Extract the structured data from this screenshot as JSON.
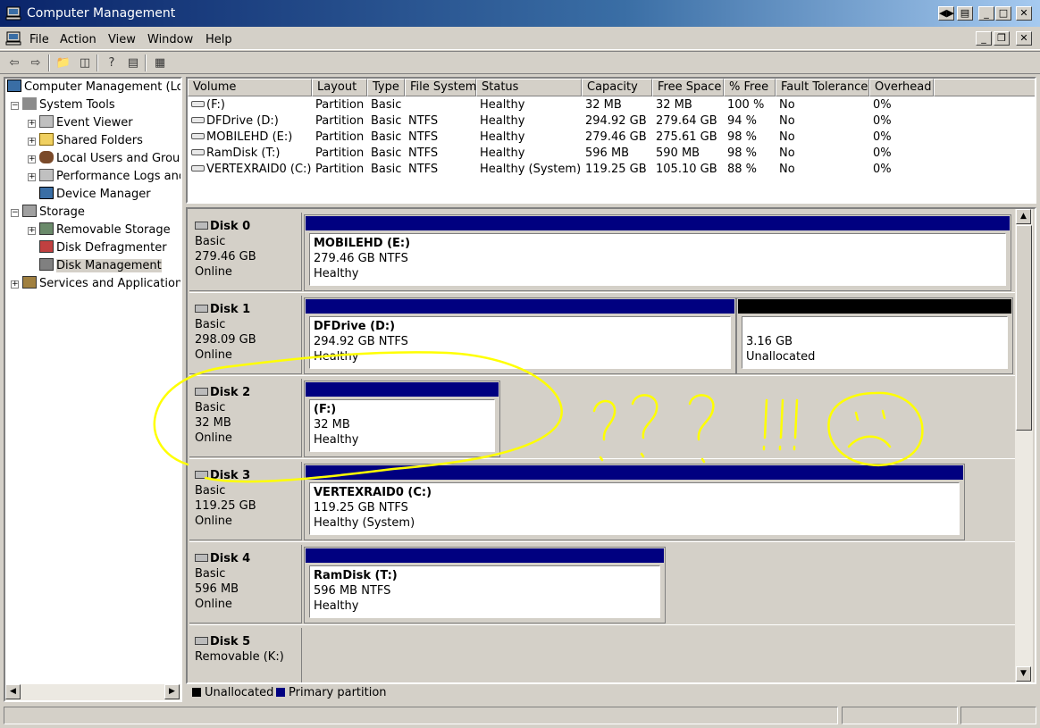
{
  "window": {
    "title": "Computer Management"
  },
  "menu": [
    "File",
    "Action",
    "View",
    "Window",
    "Help"
  ],
  "tree": {
    "items": [
      {
        "label": "Computer Management (Loc",
        "icon": "computer-icon"
      },
      {
        "label": "System Tools",
        "icon": "tools-icon"
      },
      {
        "label": "Event Viewer",
        "icon": "event-viewer-icon"
      },
      {
        "label": "Shared Folders",
        "icon": "folder-icon"
      },
      {
        "label": "Local Users and Group",
        "icon": "users-icon"
      },
      {
        "label": "Performance Logs and",
        "icon": "performance-icon"
      },
      {
        "label": "Device Manager",
        "icon": "device-icon"
      },
      {
        "label": "Storage",
        "icon": "storage-icon"
      },
      {
        "label": "Removable Storage",
        "icon": "removable-icon"
      },
      {
        "label": "Disk Defragmenter",
        "icon": "defrag-icon"
      },
      {
        "label": "Disk Management",
        "icon": "disk-management-icon"
      },
      {
        "label": "Services and Applications",
        "icon": "services-icon"
      }
    ]
  },
  "volumes": {
    "columns": [
      "Volume",
      "Layout",
      "Type",
      "File System",
      "Status",
      "Capacity",
      "Free Space",
      "% Free",
      "Fault Tolerance",
      "Overhead"
    ],
    "rows": [
      [
        "(F:)",
        "Partition",
        "Basic",
        "",
        "Healthy",
        "32 MB",
        "32 MB",
        "100 %",
        "No",
        "0%"
      ],
      [
        "DFDrive (D:)",
        "Partition",
        "Basic",
        "NTFS",
        "Healthy",
        "294.92 GB",
        "279.64 GB",
        "94 %",
        "No",
        "0%"
      ],
      [
        "MOBILEHD (E:)",
        "Partition",
        "Basic",
        "NTFS",
        "Healthy",
        "279.46 GB",
        "275.61 GB",
        "98 %",
        "No",
        "0%"
      ],
      [
        "RamDisk (T:)",
        "Partition",
        "Basic",
        "NTFS",
        "Healthy",
        "596 MB",
        "590 MB",
        "98 %",
        "No",
        "0%"
      ],
      [
        "VERTEXRAID0 (C:)",
        "Partition",
        "Basic",
        "NTFS",
        "Healthy (System)",
        "119.25 GB",
        "105.10 GB",
        "88 %",
        "No",
        "0%"
      ]
    ]
  },
  "disks": [
    {
      "name": "Disk 0",
      "type": "Basic",
      "size": "279.46 GB",
      "state": "Online",
      "partitions": [
        {
          "volume": "MOBILEHD  (E:)",
          "detail": "279.46 GB NTFS",
          "status": "Healthy",
          "kind": "primary"
        }
      ]
    },
    {
      "name": "Disk 1",
      "type": "Basic",
      "size": "298.09 GB",
      "state": "Online",
      "partitions": [
        {
          "volume": "DFDrive  (D:)",
          "detail": "294.92 GB NTFS",
          "status": "Healthy",
          "kind": "primary"
        },
        {
          "volume": "",
          "detail": "3.16 GB",
          "status": "Unallocated",
          "kind": "unallocated"
        }
      ]
    },
    {
      "name": "Disk 2",
      "type": "Basic",
      "size": "32 MB",
      "state": "Online",
      "partitions": [
        {
          "volume": "(F:)",
          "detail": "32 MB",
          "status": "Healthy",
          "kind": "primary"
        }
      ]
    },
    {
      "name": "Disk 3",
      "type": "Basic",
      "size": "119.25 GB",
      "state": "Online",
      "partitions": [
        {
          "volume": "VERTEXRAID0  (C:)",
          "detail": "119.25 GB NTFS",
          "status": "Healthy (System)",
          "kind": "primary"
        }
      ]
    },
    {
      "name": "Disk 4",
      "type": "Basic",
      "size": "596 MB",
      "state": "Online",
      "partitions": [
        {
          "volume": "RamDisk  (T:)",
          "detail": "596 MB NTFS",
          "status": "Healthy",
          "kind": "primary"
        }
      ]
    },
    {
      "name": "Disk 5",
      "type": "Removable (K:)",
      "size": "",
      "state": "",
      "partitions": []
    }
  ],
  "legend": [
    {
      "label": "Unallocated",
      "color": "#000000"
    },
    {
      "label": "Primary partition",
      "color": "#000080"
    }
  ],
  "colors": {
    "primary": "#000080",
    "unallocated": "#000000",
    "annotation": "#ffff00"
  },
  "annotation": {
    "text": "??? !!!"
  }
}
